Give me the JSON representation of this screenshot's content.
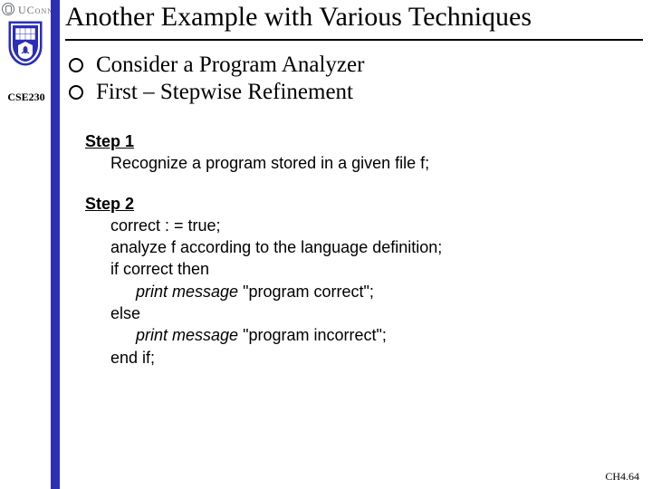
{
  "branding": {
    "university": "UConn",
    "course_code": "CSE230"
  },
  "slide": {
    "title": "Another Example with Various Techniques",
    "bullets": [
      "Consider a Program Analyzer",
      "First – Stepwise Refinement"
    ],
    "step1": {
      "heading": "Step 1",
      "lines": [
        "Recognize a program stored in a given file f;"
      ]
    },
    "step2": {
      "heading": "Step 2",
      "l1": "correct : = true;",
      "l2": "analyze f according to the language definition;",
      "l3": "if correct then",
      "l4_pre": "print message",
      "l4_q": " \"program correct\";",
      "l5": "else",
      "l6_pre": "print message",
      "l6_q": " \"program incorrect\";",
      "l7": "end if;"
    },
    "footer": "CH4.64"
  }
}
